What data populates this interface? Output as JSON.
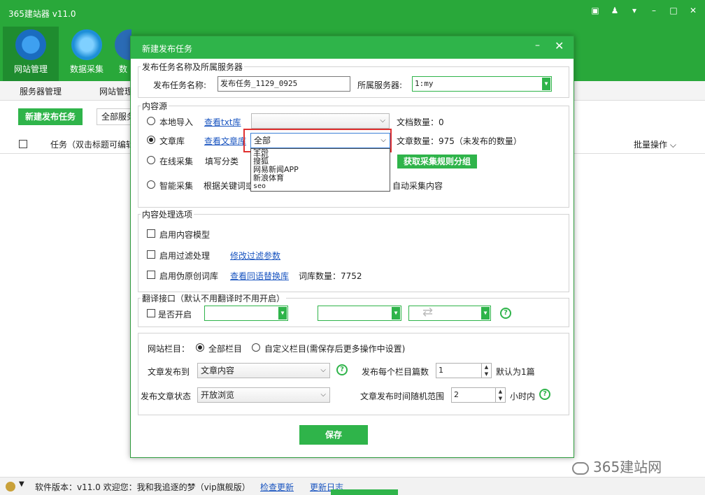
{
  "app": {
    "title": "365建站器 v11.0",
    "nav": [
      {
        "label": "网站管理",
        "color": "#1a6cc0"
      },
      {
        "label": "数据采集",
        "color": "#1e8fd8"
      },
      {
        "label": "数",
        "color": "#2a6bb5"
      }
    ],
    "subnav": [
      "服务器管理",
      "网站管理"
    ],
    "new_task_button": "新建发布任务",
    "all_server": "全部服务",
    "list_header_task": "任务（双击标题可编辑",
    "batch_operation": "批量操作",
    "status": {
      "version_text": "软件版本：v11.0  欢迎您：我和我追逐的梦（vip旗舰版）",
      "check_update": "检查更新",
      "update_log": "更新日志"
    },
    "watermark": "365建站网"
  },
  "dialog": {
    "title": "新建发布任务",
    "section_name": {
      "title": "发布任务名称及所属服务器",
      "task_name_label": "发布任务名称:",
      "task_name_value": "发布任务_1129_0925",
      "server_label": "所属服务器:",
      "server_value": "1:my"
    },
    "section_source": {
      "title": "内容源",
      "local_import": "本地导入",
      "view_txt": "查看txt库",
      "doc_count": "文档数量：0",
      "article_lib": "文章库",
      "view_article": "查看文章库",
      "article_select": "全部",
      "article_count": "文章数量：975（未发布的数量）",
      "online_collect": "在线采集",
      "fill_category": "填写分类",
      "get_rules_button": "获取采集规则分组",
      "smart_collect": "智能采集",
      "keywords_text": "根据关键词或",
      "auto_collect": "自动采集内容",
      "dropdown_options": [
        "全部",
        "手机",
        "搜狐",
        "网易新闻APP",
        "新浪体育",
        "seo"
      ]
    },
    "section_processing": {
      "title": "内容处理选项",
      "enable_model": "启用内容模型",
      "enable_filter": "启用过滤处理",
      "modify_filter": "修改过滤参数",
      "enable_pseudo": "启用伪原创词库",
      "view_synonyms": "查看同语替换库",
      "lexicon_count": "词库数量：7752"
    },
    "section_translate": {
      "title": "翻译接口（默认不用翻译时不用开启）",
      "enable": "是否开启"
    },
    "section_publish": {
      "site_column_label": "网站栏目：",
      "all_columns": "全部栏目",
      "custom_columns": "自定义栏目(需保存后更多操作中设置)",
      "publish_to_label": "文章发布到",
      "publish_to_value": "文章内容",
      "per_column_label": "发布每个栏目篇数",
      "per_column_value": "1",
      "default_one": "默认为1篇",
      "status_label": "发布文章状态",
      "status_value": "开放浏览",
      "random_range_label": "文章发布时间随机范围",
      "random_range_value": "2",
      "hours_within": "小时内"
    },
    "save_button": "保存"
  }
}
